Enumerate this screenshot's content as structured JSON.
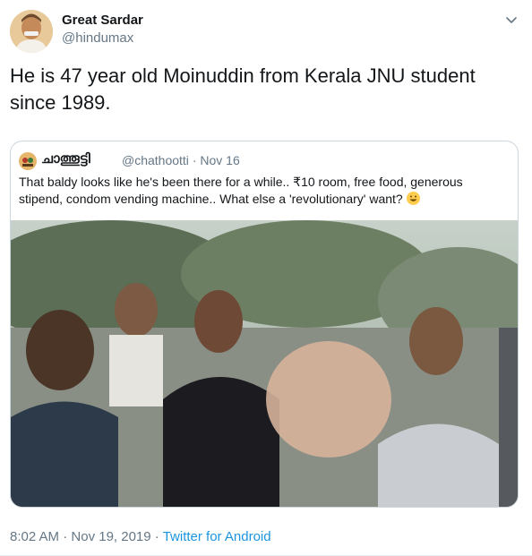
{
  "author": {
    "name": "Great Sardar",
    "handle": "@hindumax",
    "avatar_icon": "portrait-avatar"
  },
  "tweet": {
    "text": "He is 47 year old Moinuddin from Kerala JNU student since 1989.",
    "time": "8:02 AM",
    "separator": "·",
    "date": "Nov 19, 2019",
    "source": "Twitter for Android"
  },
  "quoted": {
    "name": "ചാത്തൂട്ടി",
    "handle": "@chathootti",
    "separator": "·",
    "date": "Nov 16",
    "text": "That baldy looks like he's been there for a while.. ₹10 room, free food, generous stipend, condom vending machine.. What else a 'revolutionary' want?",
    "emoji_icon": "grinning-face-emoji",
    "media_icon": "video-still-photo"
  },
  "colors": {
    "text": "#14171a",
    "secondary": "#657786",
    "link": "#1b95e0",
    "border": "#ccd6dd"
  }
}
